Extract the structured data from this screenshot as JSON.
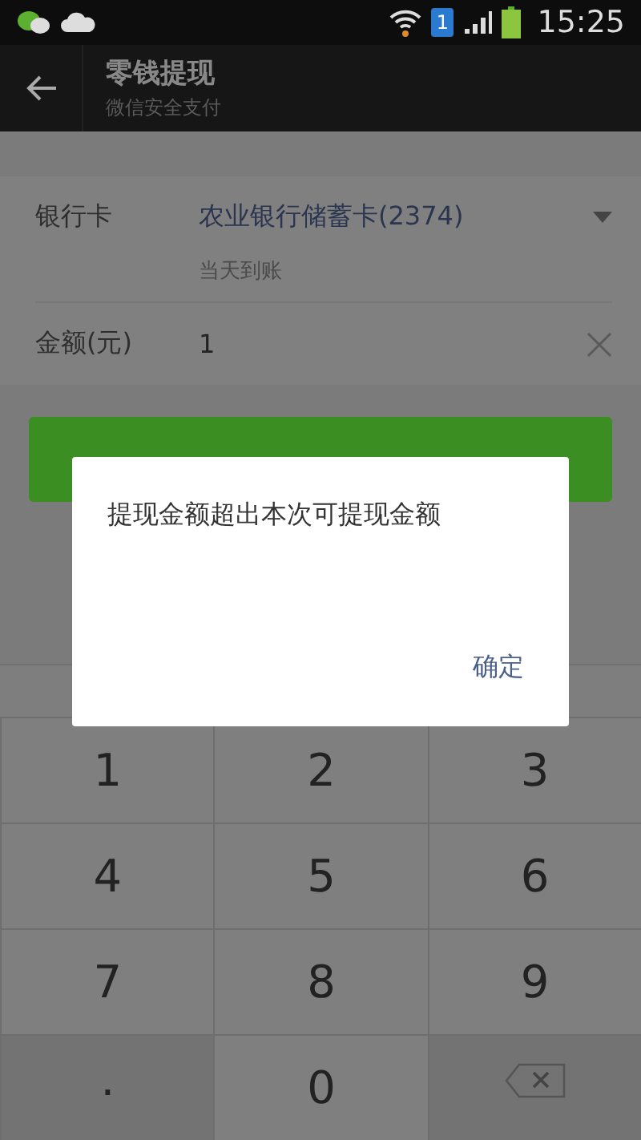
{
  "status_bar": {
    "time": "15:25",
    "sim": "1"
  },
  "toolbar": {
    "title": "零钱提现",
    "subtitle": "微信安全支付"
  },
  "form": {
    "bank_label": "银行卡",
    "bank_value": "农业银行储蓄卡(2374)",
    "bank_note": "当天到账",
    "amount_label": "金额(元)",
    "amount_value": "1"
  },
  "next_button": {
    "kind": "covered"
  },
  "dialog": {
    "message": "提现金额超出本次可提现金额",
    "ok": "确定"
  },
  "keypad": [
    {
      "kind": "digit",
      "label": "1"
    },
    {
      "kind": "digit",
      "label": "2"
    },
    {
      "kind": "digit",
      "label": "3"
    },
    {
      "kind": "digit",
      "label": "4"
    },
    {
      "kind": "digit",
      "label": "5"
    },
    {
      "kind": "digit",
      "label": "6"
    },
    {
      "kind": "digit",
      "label": "7"
    },
    {
      "kind": "digit",
      "label": "8"
    },
    {
      "kind": "digit",
      "label": "9"
    },
    {
      "kind": "side",
      "label": "."
    },
    {
      "kind": "digit",
      "label": "0"
    },
    {
      "kind": "delete"
    }
  ]
}
